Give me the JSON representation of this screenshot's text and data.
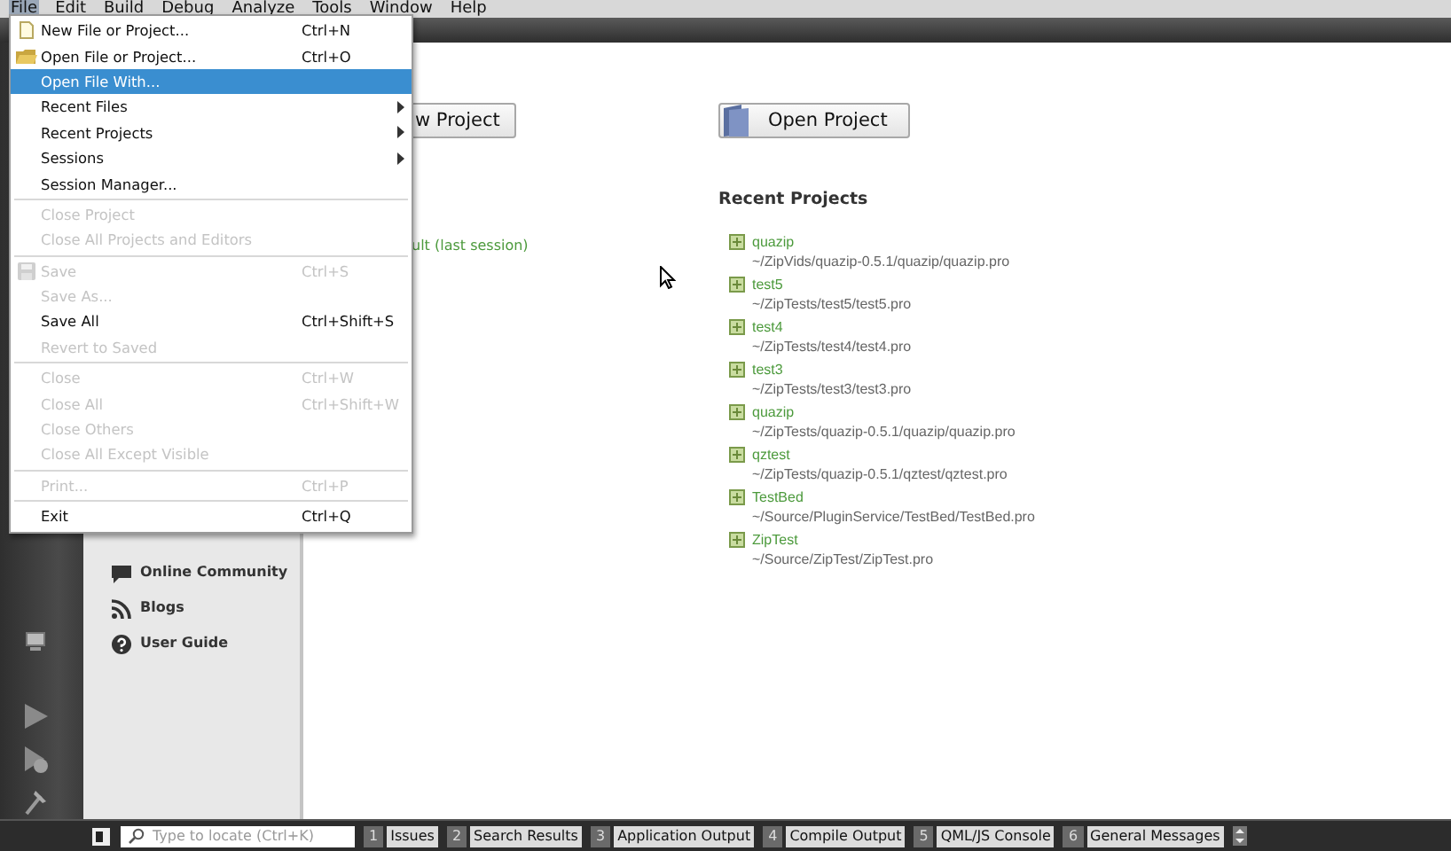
{
  "menubar": [
    {
      "label": "File",
      "selected": true
    },
    {
      "label": "Edit",
      "selected": false
    },
    {
      "label": "Build",
      "selected": false
    },
    {
      "label": "Debug",
      "selected": false
    },
    {
      "label": "Analyze",
      "selected": false
    },
    {
      "label": "Tools",
      "selected": false
    },
    {
      "label": "Window",
      "selected": false
    },
    {
      "label": "Help",
      "selected": false
    }
  ],
  "file_menu": [
    {
      "kind": "file-item",
      "label": "New File or Project...",
      "shortcut": "Ctrl+N",
      "disabled": false,
      "selected": false,
      "submenu": false
    },
    {
      "kind": "folder-item",
      "label": "Open File or Project...",
      "shortcut": "Ctrl+O",
      "disabled": false,
      "selected": false,
      "submenu": false
    },
    {
      "kind": "item",
      "label": "Open File With...",
      "disabled": false,
      "selected": true,
      "submenu": false
    },
    {
      "kind": "item",
      "label": "Recent Files",
      "disabled": false,
      "selected": false,
      "submenu": true
    },
    {
      "kind": "item",
      "label": "Recent Projects",
      "disabled": false,
      "selected": false,
      "submenu": true
    },
    {
      "kind": "item",
      "label": "Sessions",
      "disabled": false,
      "selected": false,
      "submenu": true
    },
    {
      "kind": "item",
      "label": "Session Manager...",
      "disabled": false,
      "selected": false,
      "submenu": false
    },
    {
      "kind": "separator"
    },
    {
      "kind": "item",
      "label": "Close Project",
      "disabled": true,
      "selected": false,
      "submenu": false
    },
    {
      "kind": "item",
      "label": "Close All Projects and Editors",
      "disabled": true,
      "selected": false,
      "submenu": false
    },
    {
      "kind": "separator"
    },
    {
      "kind": "disk-item",
      "label": "Save",
      "shortcut": "Ctrl+S",
      "disabled": true,
      "selected": false,
      "submenu": false
    },
    {
      "kind": "item",
      "label": "Save As...",
      "disabled": true,
      "selected": false,
      "submenu": false
    },
    {
      "kind": "item",
      "label": "Save All",
      "shortcut": "Ctrl+Shift+S",
      "disabled": false,
      "selected": false,
      "submenu": false
    },
    {
      "kind": "item",
      "label": "Revert to Saved",
      "disabled": true,
      "selected": false,
      "submenu": false
    },
    {
      "kind": "separator"
    },
    {
      "kind": "item",
      "label": "Close",
      "shortcut": "Ctrl+W",
      "disabled": true,
      "selected": false,
      "submenu": false
    },
    {
      "kind": "item",
      "label": "Close All",
      "shortcut": "Ctrl+Shift+W",
      "disabled": true,
      "selected": false,
      "submenu": false
    },
    {
      "kind": "item",
      "label": "Close Others",
      "disabled": true,
      "selected": false,
      "submenu": false
    },
    {
      "kind": "item",
      "label": "Close All Except Visible",
      "disabled": true,
      "selected": false,
      "submenu": false
    },
    {
      "kind": "separator"
    },
    {
      "kind": "item",
      "label": "Print...",
      "shortcut": "Ctrl+P",
      "disabled": true,
      "selected": false,
      "submenu": false
    },
    {
      "kind": "separator"
    },
    {
      "kind": "item",
      "label": "Exit",
      "shortcut": "Ctrl+Q",
      "disabled": false,
      "selected": false,
      "submenu": false
    }
  ],
  "side_links": [
    {
      "kind": "community",
      "label": "Online Community"
    },
    {
      "kind": "blogs",
      "label": "Blogs"
    },
    {
      "kind": "guide",
      "label": "User Guide"
    }
  ],
  "new_project_button": "w Project",
  "session": "ult (last session)",
  "open_project_button": "Open Project",
  "recent_projects": {
    "title": "Recent Projects",
    "items": [
      {
        "name": "quazip",
        "path": "~/ZipVids/quazip-0.5.1/quazip/quazip.pro"
      },
      {
        "name": "test5",
        "path": "~/ZipTests/test5/test5.pro"
      },
      {
        "name": "test4",
        "path": "~/ZipTests/test4/test4.pro"
      },
      {
        "name": "test3",
        "path": "~/ZipTests/test3/test3.pro"
      },
      {
        "name": "quazip",
        "path": "~/ZipTests/quazip-0.5.1/quazip/quazip.pro"
      },
      {
        "name": "qztest",
        "path": "~/ZipTests/quazip-0.5.1/qztest/qztest.pro"
      },
      {
        "name": "TestBed",
        "path": "~/Source/PluginService/TestBed/TestBed.pro"
      },
      {
        "name": "ZipTest",
        "path": "~/Source/ZipTest/ZipTest.pro"
      }
    ]
  },
  "locator": {
    "placeholder": "Type to locate (Ctrl+K)"
  },
  "output_tabs": [
    {
      "number": "1",
      "label": "Issues"
    },
    {
      "number": "2",
      "label": "Search Results"
    },
    {
      "number": "3",
      "label": "Application Output"
    },
    {
      "number": "4",
      "label": "Compile Output"
    },
    {
      "number": "5",
      "label": "QML/JS Console"
    },
    {
      "number": "6",
      "label": "General Messages"
    }
  ]
}
